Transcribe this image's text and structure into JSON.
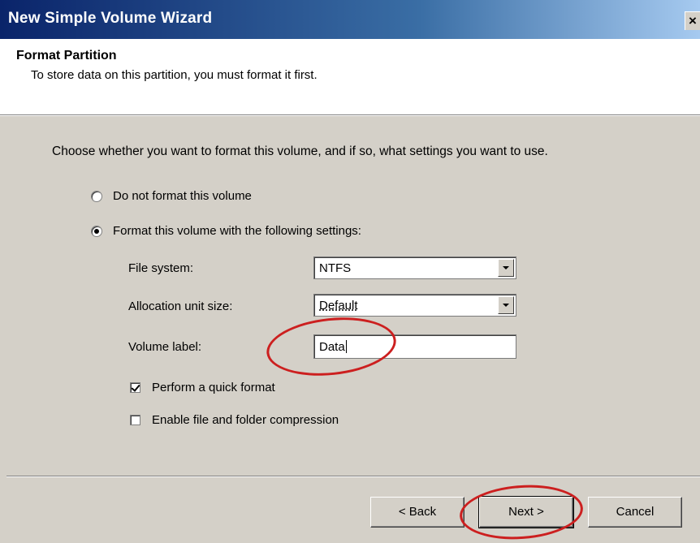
{
  "window": {
    "title": "New Simple Volume Wizard",
    "close_glyph": "×"
  },
  "header": {
    "title": "Format Partition",
    "subtitle": "To store data on this partition, you must format it first."
  },
  "body": {
    "instruction": "Choose whether you want to format this volume, and if so, what settings you want to use.",
    "options": {
      "no_format": "Do not format this volume",
      "format_with": "Format this volume with the following settings:",
      "selected": "format_with"
    },
    "file_system": {
      "label": "File system:",
      "value": "NTFS"
    },
    "allocation": {
      "label": "Allocation unit size:",
      "value": "Default"
    },
    "volume_label": {
      "label": "Volume label:",
      "value": "Data"
    },
    "quick_format": {
      "label": "Perform a quick format",
      "checked": true
    },
    "compression": {
      "label": "Enable file and folder compression",
      "checked": false
    }
  },
  "buttons": {
    "back": "< Back",
    "next": "Next >",
    "cancel": "Cancel"
  },
  "colors": {
    "annotation": "#cc1f1f",
    "titlebar": "#0a246a",
    "dialog_bg": "#d4d0c8"
  }
}
